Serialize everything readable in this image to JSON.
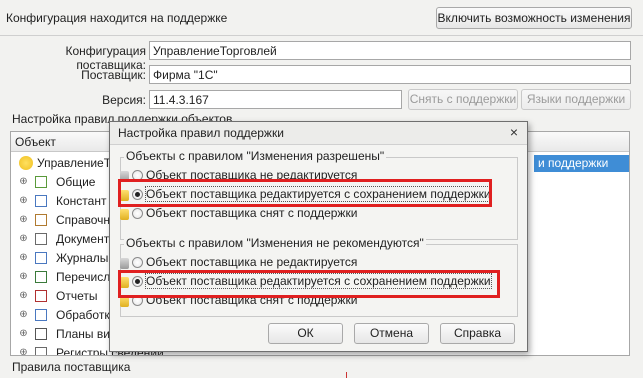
{
  "status": "Конфигурация находится на поддержке",
  "enable_changes_button": "Включить возможность изменения",
  "fields": {
    "vendor_config_label": "Конфигурация поставщика:",
    "vendor_config_value": "УправлениеТорговлей",
    "vendor_label": "Поставщик:",
    "vendor_value": "Фирма \"1С\"",
    "version_label": "Версия:",
    "version_value": "11.4.3.167"
  },
  "remove_support_button": "Снять с поддержки",
  "support_languages_button": "Языки поддержки",
  "rules_group_title": "Настройка правил поддержки объектов",
  "tree": {
    "column_object": "Объект",
    "selected_cell": "и поддержки",
    "rows": [
      {
        "label": "УправлениеТо",
        "icon": "config-icon",
        "expand": ""
      },
      {
        "label": "Общие",
        "icon": "common-icon",
        "expand": "⊕"
      },
      {
        "label": "Констант",
        "icon": "constants-icon",
        "expand": "⊕"
      },
      {
        "label": "Справочни",
        "icon": "catalogs-icon",
        "expand": "⊕"
      },
      {
        "label": "Документ",
        "icon": "documents-icon",
        "expand": "⊕"
      },
      {
        "label": "Журналы д",
        "icon": "journals-icon",
        "expand": "⊕"
      },
      {
        "label": "Перечисле",
        "icon": "enums-icon",
        "expand": "⊕"
      },
      {
        "label": "Отчеты",
        "icon": "reports-icon",
        "expand": "⊕"
      },
      {
        "label": "Обработк",
        "icon": "dataprocessors-icon",
        "expand": "⊕"
      },
      {
        "label": "Планы вид",
        "icon": "charts-icon",
        "expand": "⊕"
      },
      {
        "label": "Регистры сведений",
        "icon": "registers-icon",
        "expand": "⊕"
      }
    ]
  },
  "vendor_rules_title": "Правила поставщика",
  "dialog": {
    "title": "Настройка правил поддержки",
    "close": "×",
    "group1_title": "Объекты с правилом \"Изменения разрешены\"",
    "group1_options": [
      "Объект поставщика не редактируется",
      "Объект поставщика редактируется с сохранением поддержки",
      "Объект поставщика снят с поддержки"
    ],
    "group1_selected": 1,
    "group2_title": "Объекты с правилом \"Изменения не рекомендуются\"",
    "group2_options": [
      "Объект поставщика не редактируется",
      "Объект поставщика редактируется с сохранением поддержки",
      "Объект поставщика снят с поддержки"
    ],
    "group2_selected": 1,
    "ok": "ОК",
    "cancel": "Отмена",
    "help": "Справка"
  },
  "colors": {
    "highlight": "#e02020",
    "selection": "#3f8dd6"
  }
}
